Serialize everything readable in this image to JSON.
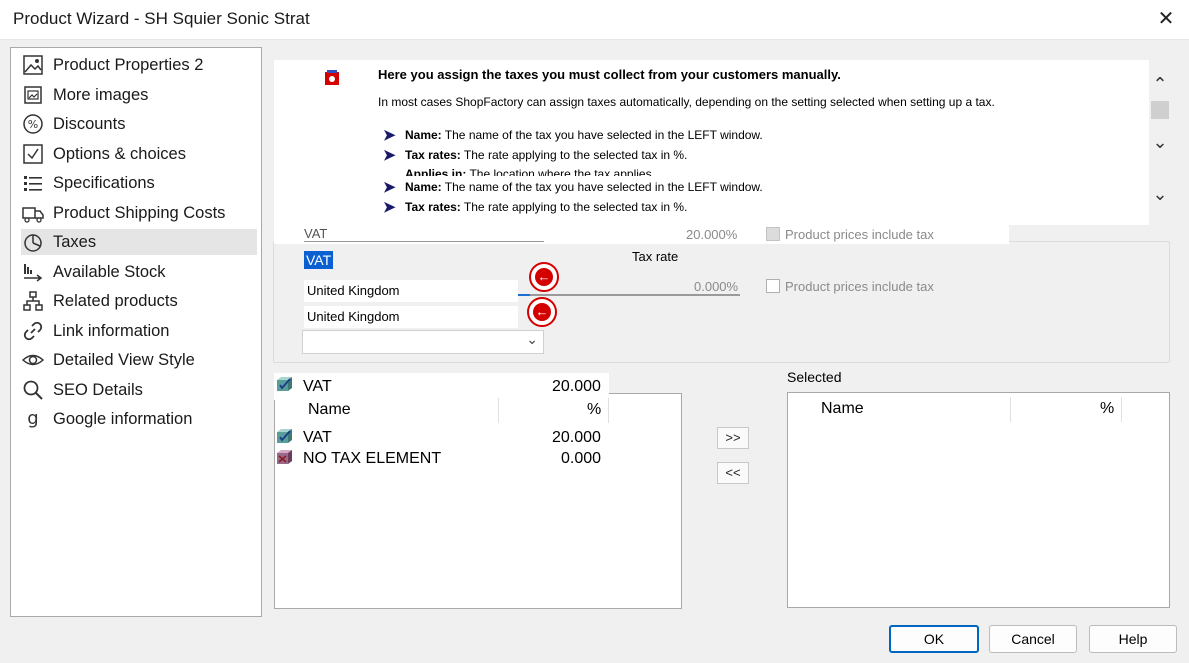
{
  "window": {
    "title": "Product Wizard - SH Squier Sonic Strat",
    "close_glyph": "✕"
  },
  "sidebar": {
    "items": [
      {
        "label": "Product Properties 2",
        "icon": "image-icon"
      },
      {
        "label": "More images",
        "icon": "images-icon"
      },
      {
        "label": "Discounts",
        "icon": "percent-icon"
      },
      {
        "label": "Options & choices",
        "icon": "checkbox-icon"
      },
      {
        "label": "Specifications",
        "icon": "list-icon"
      },
      {
        "label": "Product Shipping Costs",
        "icon": "truck-icon"
      },
      {
        "label": "Taxes",
        "icon": "pie-chart-icon",
        "selected": true
      },
      {
        "label": "Available Stock",
        "icon": "stock-icon"
      },
      {
        "label": "Related products",
        "icon": "hierarchy-icon"
      },
      {
        "label": "Link information",
        "icon": "link-icon"
      },
      {
        "label": "Detailed View Style",
        "icon": "eye-icon"
      },
      {
        "label": "SEO Details",
        "icon": "search-icon"
      },
      {
        "label": "Google information",
        "icon": "google-icon"
      }
    ]
  },
  "help": {
    "heading": "Here you assign the taxes you must collect from your customers manually.",
    "intro": "In most cases ShopFactory can assign taxes automatically,  depending on the setting selected when setting up a tax.",
    "bullets": [
      {
        "term": "Name:",
        "text": " The name of the tax you have selected in the LEFT window."
      },
      {
        "term": "Tax rates:",
        "text": " The rate applying to the selected tax in %."
      },
      {
        "term": "Applies in:",
        "text": " The location where the tax applies."
      },
      {
        "term": "Name:",
        "text": " The name of the tax you have selected in the LEFT window."
      },
      {
        "term": "Tax rates:",
        "text": " The rate applying to the selected tax in %."
      }
    ]
  },
  "tax_panel": {
    "ghost_name": "VAT",
    "ghost_rate": "20.000%",
    "ghost_checkbox_label": "Product prices include tax",
    "name_value": "VAT",
    "tax_rate_label": "Tax rate",
    "location_1": "United Kingdom",
    "location_2": "United Kingdom",
    "rate_value": "0.000%",
    "checkbox_label": "Product prices include tax",
    "dropdown_value": ""
  },
  "available_list": {
    "ghost_row": {
      "name": "VAT",
      "value": "20.000"
    },
    "header": {
      "name": "Name",
      "pct": "%"
    },
    "rows": [
      {
        "name": "VAT",
        "value": "20.000"
      },
      {
        "name": "NO TAX ELEMENT",
        "value": "0.000"
      }
    ]
  },
  "transfer": {
    "add": ">>",
    "remove": "<<"
  },
  "selected_list": {
    "label": "Selected",
    "header": {
      "name": "Name",
      "pct": "%"
    }
  },
  "buttons": {
    "ok": "OK",
    "cancel": "Cancel",
    "help": "Help"
  },
  "colors": {
    "accent": "#0067c0",
    "danger": "#d40000",
    "help_arrow": "#1a1a6a"
  }
}
